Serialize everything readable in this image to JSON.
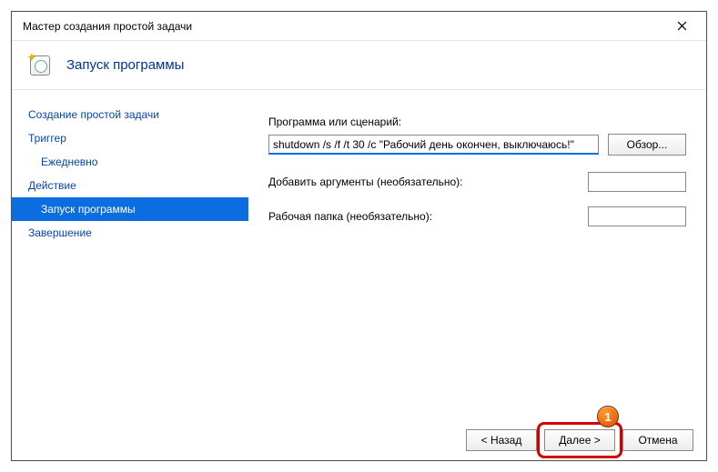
{
  "window": {
    "title": "Мастер создания простой задачи"
  },
  "header": {
    "title": "Запуск программы"
  },
  "sidebar": {
    "items": [
      {
        "label": "Создание простой задачи",
        "sub": false,
        "selected": false
      },
      {
        "label": "Триггер",
        "sub": false,
        "selected": false
      },
      {
        "label": "Ежедневно",
        "sub": true,
        "selected": false
      },
      {
        "label": "Действие",
        "sub": false,
        "selected": false
      },
      {
        "label": "Запуск программы",
        "sub": true,
        "selected": true
      },
      {
        "label": "Завершение",
        "sub": false,
        "selected": false
      }
    ]
  },
  "content": {
    "program_label": "Программа или сценарий:",
    "program_value": "shutdown /s /f /t 30 /c \"Рабочий день окончен, выключаюсь!\"",
    "browse_label": "Обзор...",
    "args_label": "Добавить аргументы (необязательно):",
    "args_value": "",
    "startdir_label": "Рабочая папка (необязательно):",
    "startdir_value": ""
  },
  "footer": {
    "back": "< Назад",
    "next": "Далее >",
    "cancel": "Отмена"
  },
  "annotation": {
    "badge": "1"
  }
}
